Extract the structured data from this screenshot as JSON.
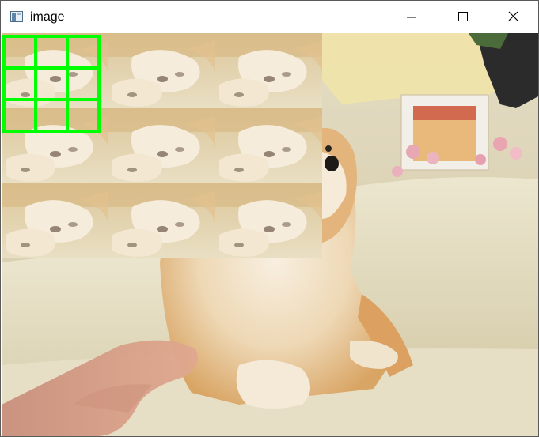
{
  "window": {
    "title": "image",
    "controls": {
      "minimize": "minimize-icon",
      "maximize": "maximize-icon",
      "close": "close-icon"
    }
  },
  "image": {
    "subject": "shiba-inu-on-couch",
    "tile_rows": 3,
    "tile_cols": 3,
    "overlay_grid_rows": 3,
    "overlay_grid_cols": 3,
    "overlay_color": "#00ff00"
  }
}
